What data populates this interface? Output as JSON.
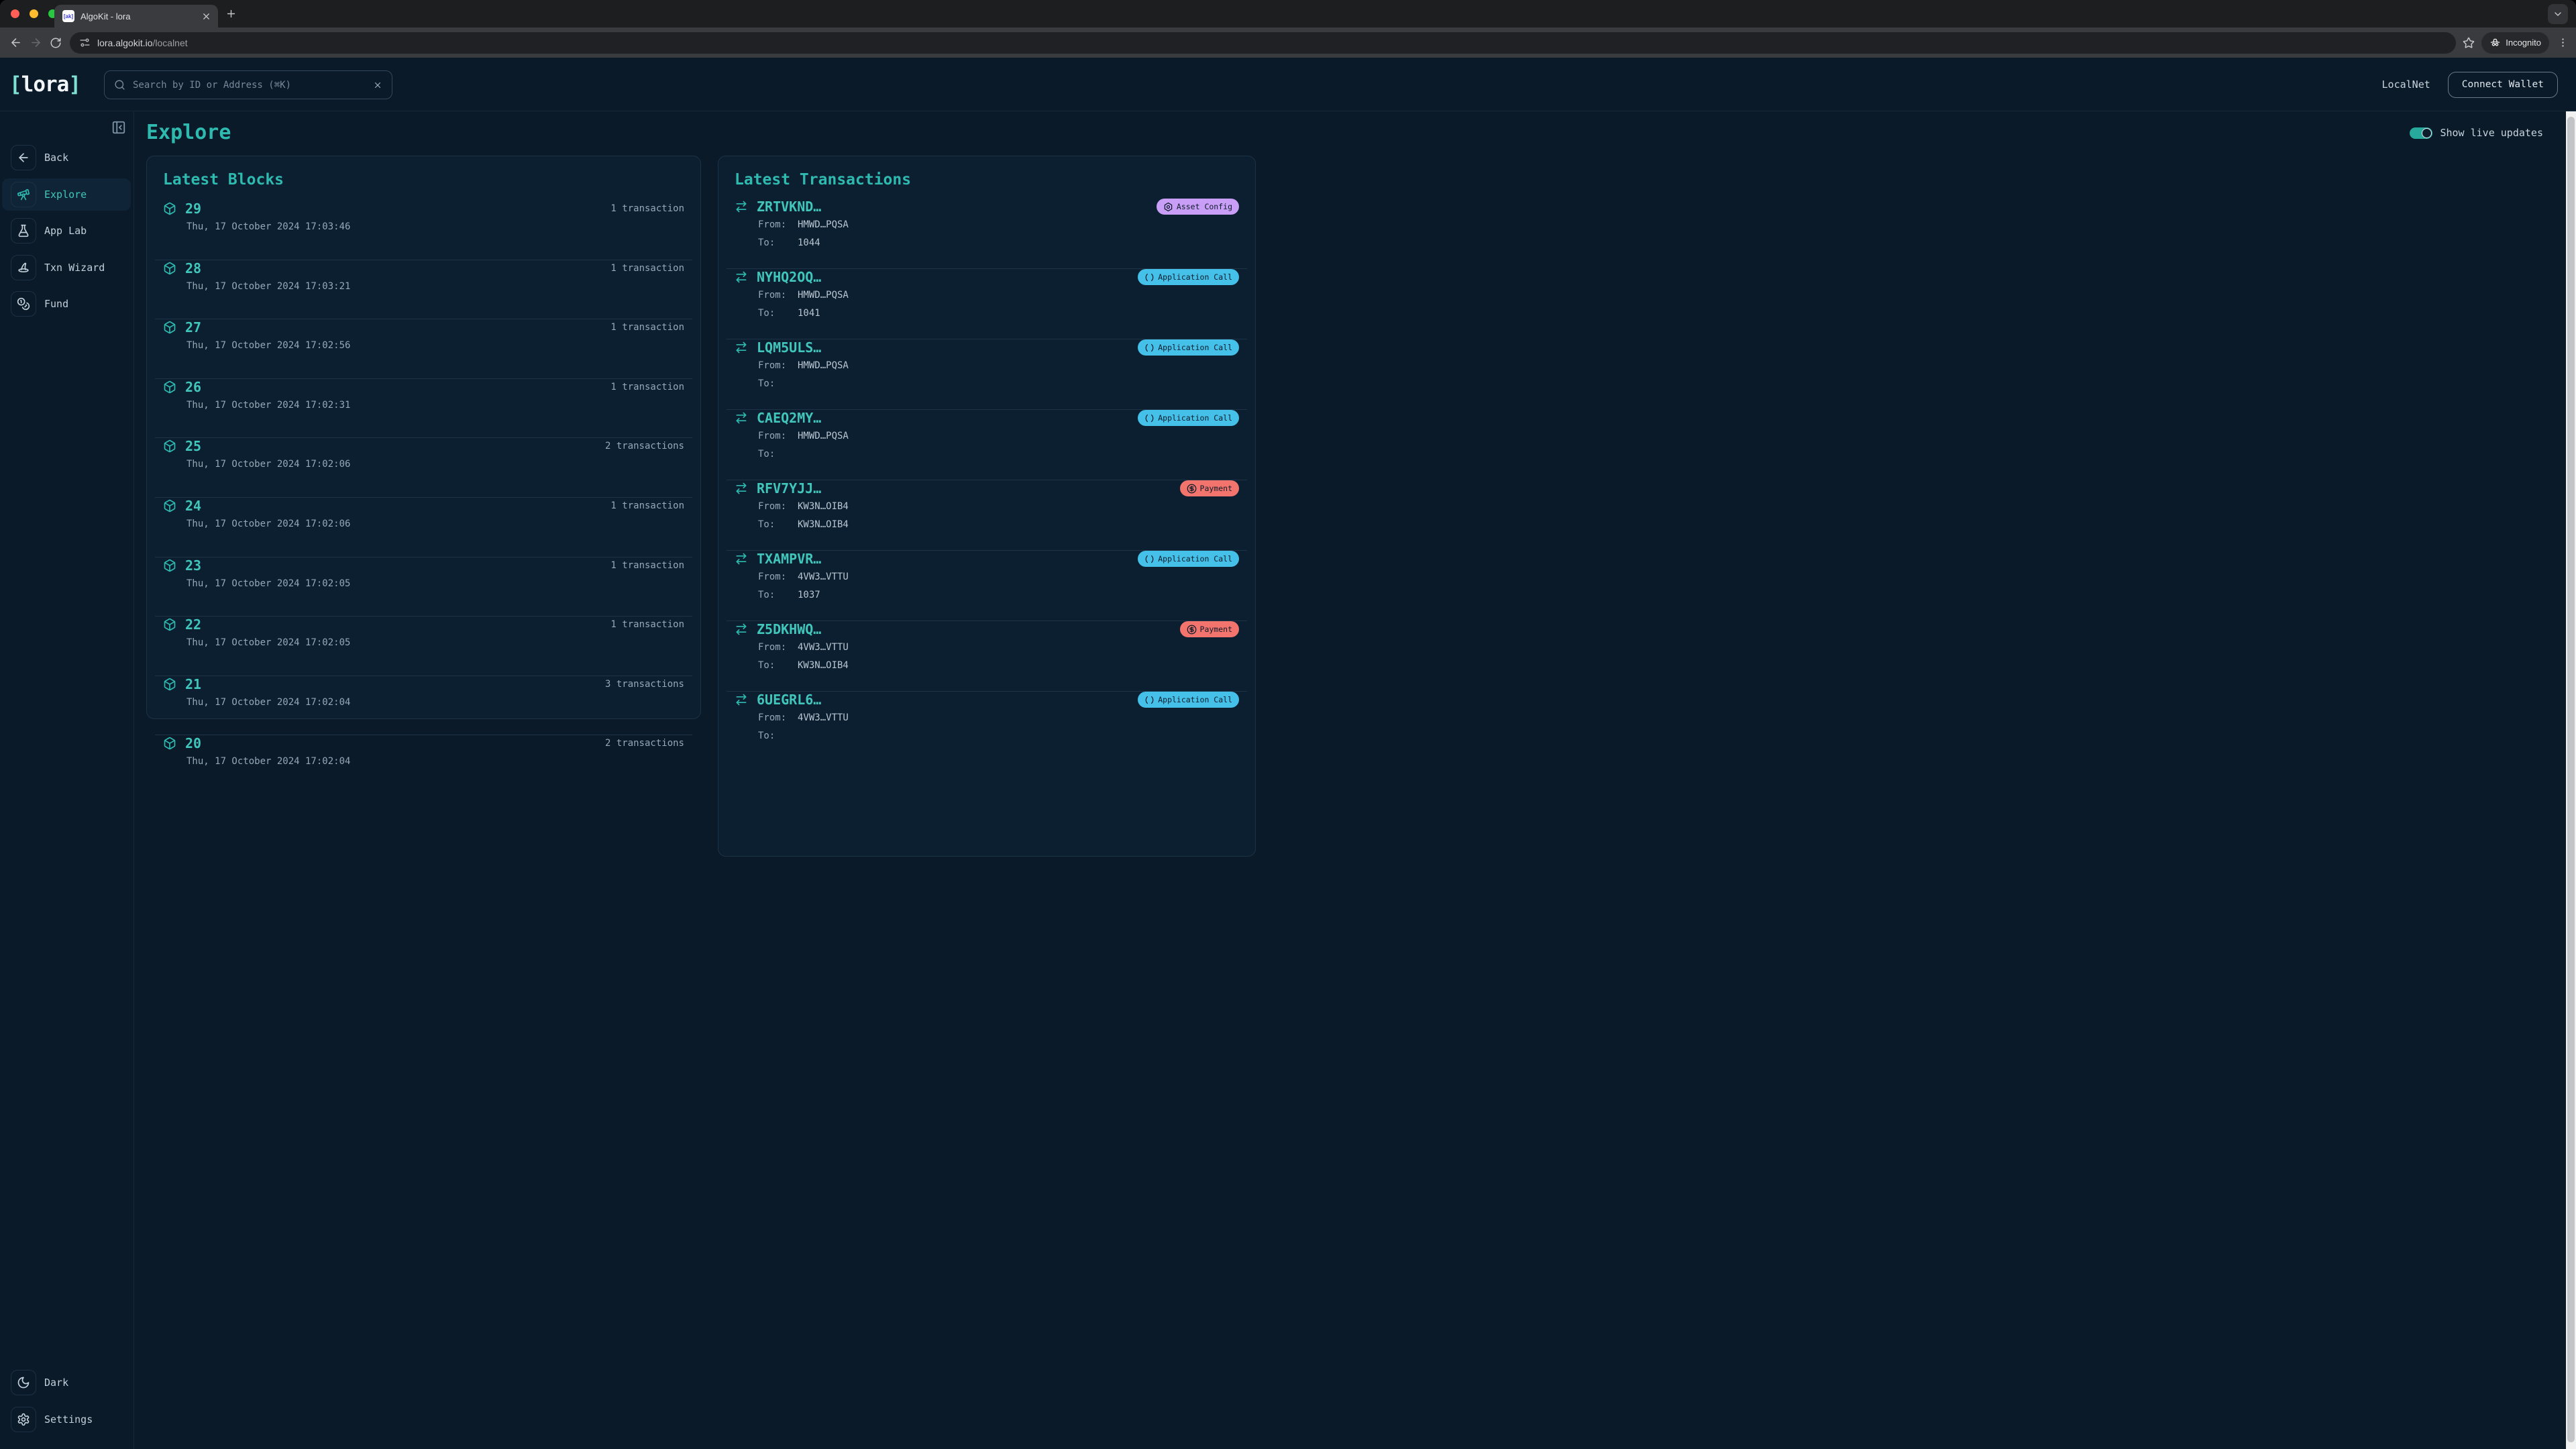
{
  "browser": {
    "tab_title": "AlgoKit - lora",
    "favicon_text": "[ak]",
    "url_domain": "lora.algokit.io",
    "url_path": "/localnet",
    "incognito_label": "Incognito"
  },
  "header": {
    "logo_prefix": "[",
    "logo_text": "lora",
    "logo_suffix": "]",
    "search_placeholder": "Search by ID or Address (⌘K)",
    "network_label": "LocalNet",
    "connect_wallet_label": "Connect Wallet"
  },
  "sidebar": {
    "items": [
      {
        "label": "Back",
        "icon": "arrow-left-icon",
        "active": false
      },
      {
        "label": "Explore",
        "icon": "telescope-icon",
        "active": true
      },
      {
        "label": "App Lab",
        "icon": "flask-icon",
        "active": false
      },
      {
        "label": "Txn Wizard",
        "icon": "wizard-hat-icon",
        "active": false
      },
      {
        "label": "Fund",
        "icon": "coins-icon",
        "active": false
      }
    ],
    "footer_items": [
      {
        "label": "Dark",
        "icon": "moon-icon"
      },
      {
        "label": "Settings",
        "icon": "gear-icon"
      }
    ]
  },
  "page": {
    "title": "Explore",
    "live_updates_label": "Show live updates",
    "live_updates_on": true
  },
  "blocks_panel": {
    "title": "Latest Blocks",
    "rows": [
      {
        "number": "29",
        "timestamp": "Thu, 17 October 2024 17:03:46",
        "count": "1 transaction"
      },
      {
        "number": "28",
        "timestamp": "Thu, 17 October 2024 17:03:21",
        "count": "1 transaction"
      },
      {
        "number": "27",
        "timestamp": "Thu, 17 October 2024 17:02:56",
        "count": "1 transaction"
      },
      {
        "number": "26",
        "timestamp": "Thu, 17 October 2024 17:02:31",
        "count": "1 transaction"
      },
      {
        "number": "25",
        "timestamp": "Thu, 17 October 2024 17:02:06",
        "count": "2 transactions"
      },
      {
        "number": "24",
        "timestamp": "Thu, 17 October 2024 17:02:06",
        "count": "1 transaction"
      },
      {
        "number": "23",
        "timestamp": "Thu, 17 October 2024 17:02:05",
        "count": "1 transaction"
      },
      {
        "number": "22",
        "timestamp": "Thu, 17 October 2024 17:02:05",
        "count": "1 transaction"
      },
      {
        "number": "21",
        "timestamp": "Thu, 17 October 2024 17:02:04",
        "count": "3 transactions"
      },
      {
        "number": "20",
        "timestamp": "Thu, 17 October 2024 17:02:04",
        "count": "2 transactions"
      }
    ]
  },
  "transactions_panel": {
    "title": "Latest Transactions",
    "from_label": "From:",
    "to_label": "To:",
    "rows": [
      {
        "id": "ZRTVKND…",
        "type": "Asset Config",
        "from": "HMWD…PQSA",
        "to": "1044"
      },
      {
        "id": "NYHQ2OQ…",
        "type": "Application Call",
        "from": "HMWD…PQSA",
        "to": "1041"
      },
      {
        "id": "LQM5ULS…",
        "type": "Application Call",
        "from": "HMWD…PQSA",
        "to": ""
      },
      {
        "id": "CAEQ2MY…",
        "type": "Application Call",
        "from": "HMWD…PQSA",
        "to": ""
      },
      {
        "id": "RFV7YJJ…",
        "type": "Payment",
        "from": "KW3N…OIB4",
        "to": "KW3N…OIB4"
      },
      {
        "id": "TXAMPVR…",
        "type": "Application Call",
        "from": "4VW3…VTTU",
        "to": "1037"
      },
      {
        "id": "Z5DKHWQ…",
        "type": "Payment",
        "from": "4VW3…VTTU",
        "to": "KW3N…OIB4"
      },
      {
        "id": "6UEGRL6…",
        "type": "Application Call",
        "from": "4VW3…VTTU",
        "to": ""
      }
    ]
  },
  "badges": {
    "Asset Config": {
      "bg": "#c89ef6",
      "icon": "asset-config-icon"
    },
    "Application Call": {
      "bg": "#45c0e9",
      "icon": "application-call-icon"
    },
    "Payment": {
      "bg": "#f3736d",
      "icon": "payment-icon"
    }
  },
  "colors": {
    "accent_teal": "#2fbab0",
    "link_teal": "#41c6bb",
    "toggle_on": "#27a99c",
    "background": "#0a1a29",
    "panel": "#0c1f30"
  }
}
